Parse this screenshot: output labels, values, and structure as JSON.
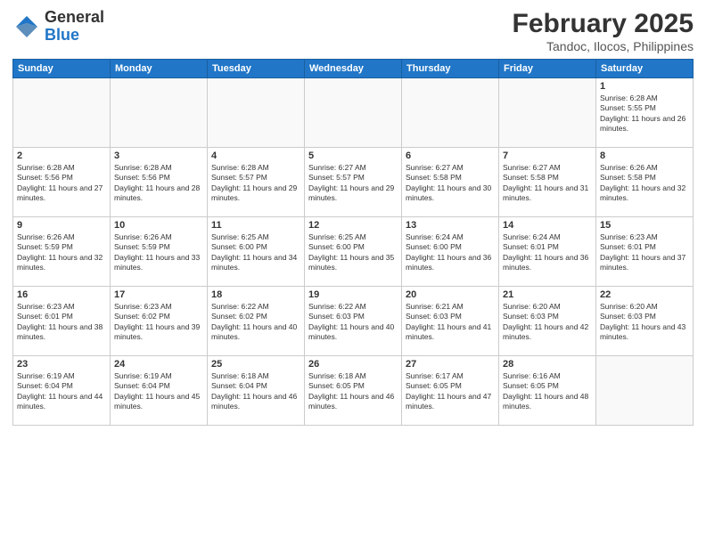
{
  "logo": {
    "general": "General",
    "blue": "Blue"
  },
  "title": "February 2025",
  "location": "Tandoc, Ilocos, Philippines",
  "days_of_week": [
    "Sunday",
    "Monday",
    "Tuesday",
    "Wednesday",
    "Thursday",
    "Friday",
    "Saturday"
  ],
  "weeks": [
    [
      {
        "day": "",
        "info": ""
      },
      {
        "day": "",
        "info": ""
      },
      {
        "day": "",
        "info": ""
      },
      {
        "day": "",
        "info": ""
      },
      {
        "day": "",
        "info": ""
      },
      {
        "day": "",
        "info": ""
      },
      {
        "day": "1",
        "info": "Sunrise: 6:28 AM\nSunset: 5:55 PM\nDaylight: 11 hours and 26 minutes."
      }
    ],
    [
      {
        "day": "2",
        "info": "Sunrise: 6:28 AM\nSunset: 5:56 PM\nDaylight: 11 hours and 27 minutes."
      },
      {
        "day": "3",
        "info": "Sunrise: 6:28 AM\nSunset: 5:56 PM\nDaylight: 11 hours and 28 minutes."
      },
      {
        "day": "4",
        "info": "Sunrise: 6:28 AM\nSunset: 5:57 PM\nDaylight: 11 hours and 29 minutes."
      },
      {
        "day": "5",
        "info": "Sunrise: 6:27 AM\nSunset: 5:57 PM\nDaylight: 11 hours and 29 minutes."
      },
      {
        "day": "6",
        "info": "Sunrise: 6:27 AM\nSunset: 5:58 PM\nDaylight: 11 hours and 30 minutes."
      },
      {
        "day": "7",
        "info": "Sunrise: 6:27 AM\nSunset: 5:58 PM\nDaylight: 11 hours and 31 minutes."
      },
      {
        "day": "8",
        "info": "Sunrise: 6:26 AM\nSunset: 5:58 PM\nDaylight: 11 hours and 32 minutes."
      }
    ],
    [
      {
        "day": "9",
        "info": "Sunrise: 6:26 AM\nSunset: 5:59 PM\nDaylight: 11 hours and 32 minutes."
      },
      {
        "day": "10",
        "info": "Sunrise: 6:26 AM\nSunset: 5:59 PM\nDaylight: 11 hours and 33 minutes."
      },
      {
        "day": "11",
        "info": "Sunrise: 6:25 AM\nSunset: 6:00 PM\nDaylight: 11 hours and 34 minutes."
      },
      {
        "day": "12",
        "info": "Sunrise: 6:25 AM\nSunset: 6:00 PM\nDaylight: 11 hours and 35 minutes."
      },
      {
        "day": "13",
        "info": "Sunrise: 6:24 AM\nSunset: 6:00 PM\nDaylight: 11 hours and 36 minutes."
      },
      {
        "day": "14",
        "info": "Sunrise: 6:24 AM\nSunset: 6:01 PM\nDaylight: 11 hours and 36 minutes."
      },
      {
        "day": "15",
        "info": "Sunrise: 6:23 AM\nSunset: 6:01 PM\nDaylight: 11 hours and 37 minutes."
      }
    ],
    [
      {
        "day": "16",
        "info": "Sunrise: 6:23 AM\nSunset: 6:01 PM\nDaylight: 11 hours and 38 minutes."
      },
      {
        "day": "17",
        "info": "Sunrise: 6:23 AM\nSunset: 6:02 PM\nDaylight: 11 hours and 39 minutes."
      },
      {
        "day": "18",
        "info": "Sunrise: 6:22 AM\nSunset: 6:02 PM\nDaylight: 11 hours and 40 minutes."
      },
      {
        "day": "19",
        "info": "Sunrise: 6:22 AM\nSunset: 6:03 PM\nDaylight: 11 hours and 40 minutes."
      },
      {
        "day": "20",
        "info": "Sunrise: 6:21 AM\nSunset: 6:03 PM\nDaylight: 11 hours and 41 minutes."
      },
      {
        "day": "21",
        "info": "Sunrise: 6:20 AM\nSunset: 6:03 PM\nDaylight: 11 hours and 42 minutes."
      },
      {
        "day": "22",
        "info": "Sunrise: 6:20 AM\nSunset: 6:03 PM\nDaylight: 11 hours and 43 minutes."
      }
    ],
    [
      {
        "day": "23",
        "info": "Sunrise: 6:19 AM\nSunset: 6:04 PM\nDaylight: 11 hours and 44 minutes."
      },
      {
        "day": "24",
        "info": "Sunrise: 6:19 AM\nSunset: 6:04 PM\nDaylight: 11 hours and 45 minutes."
      },
      {
        "day": "25",
        "info": "Sunrise: 6:18 AM\nSunset: 6:04 PM\nDaylight: 11 hours and 46 minutes."
      },
      {
        "day": "26",
        "info": "Sunrise: 6:18 AM\nSunset: 6:05 PM\nDaylight: 11 hours and 46 minutes."
      },
      {
        "day": "27",
        "info": "Sunrise: 6:17 AM\nSunset: 6:05 PM\nDaylight: 11 hours and 47 minutes."
      },
      {
        "day": "28",
        "info": "Sunrise: 6:16 AM\nSunset: 6:05 PM\nDaylight: 11 hours and 48 minutes."
      },
      {
        "day": "",
        "info": ""
      }
    ]
  ]
}
